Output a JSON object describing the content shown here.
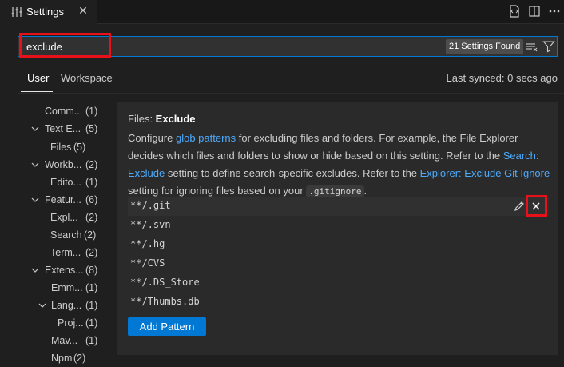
{
  "tab": {
    "title": "Settings",
    "close": "✕"
  },
  "search": {
    "value": "exclude",
    "found": "21 Settings Found"
  },
  "scope": {
    "user": "User",
    "workspace": "Workspace",
    "sync": "Last synced: 0 secs ago"
  },
  "toc": [
    {
      "label": "Comm...",
      "count": "(1)",
      "chevron": ""
    },
    {
      "label": "Text E...",
      "count": "(5)",
      "chevron": "down"
    },
    {
      "label": "Files",
      "count": "(5)",
      "chevron": ""
    },
    {
      "label": "Workb...",
      "count": "(2)",
      "chevron": "down"
    },
    {
      "label": "Edito...",
      "count": "(1)",
      "chevron": ""
    },
    {
      "label": "Featur...",
      "count": "(6)",
      "chevron": "down"
    },
    {
      "label": "Expl...",
      "count": "(2)",
      "chevron": ""
    },
    {
      "label": "Search",
      "count": "(2)",
      "chevron": ""
    },
    {
      "label": "Term...",
      "count": "(2)",
      "chevron": ""
    },
    {
      "label": "Extens...",
      "count": "(8)",
      "chevron": "down"
    },
    {
      "label": "Emm...",
      "count": "(1)",
      "chevron": ""
    },
    {
      "label": "Lang...",
      "count": "(1)",
      "chevron": "down"
    },
    {
      "label": "Proj...",
      "count": "(1)",
      "chevron": ""
    },
    {
      "label": "Mav...",
      "count": "(1)",
      "chevron": ""
    },
    {
      "label": "Npm",
      "count": "(2)",
      "chevron": ""
    }
  ],
  "setting": {
    "category": "Files: ",
    "name": "Exclude",
    "desc": {
      "l1_a": "Configure ",
      "l1_link": "glob patterns",
      "l1_b": " for excluding files and folders. For example, the File Explorer",
      "l2_a": "decides which files and folders to show or hide based on this setting. Refer to the ",
      "l2_link": "Search:",
      "l3_link": "Exclude",
      "l3_a": " setting to define search-specific excludes. Refer to the ",
      "l3_link2": "Explorer: Exclude Git Ignore",
      "l4_a": "setting for ignoring files based on your ",
      "l4_code": ".gitignore",
      "l4_b": "."
    },
    "patterns": [
      "**/.git",
      "**/.svn",
      "**/.hg",
      "**/CVS",
      "**/.DS_Store",
      "**/Thumbs.db"
    ],
    "add_label": "Add Pattern"
  }
}
